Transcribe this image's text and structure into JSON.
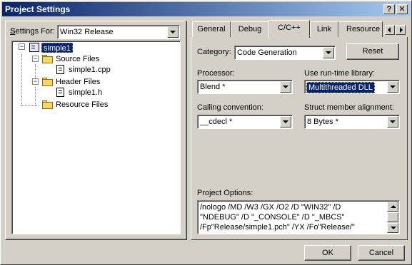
{
  "window": {
    "title": "Project Settings",
    "help_button": "?",
    "close_button": "✕"
  },
  "left_panel": {
    "settings_for_label": "Settings For:",
    "settings_for_value": "Win32 Release",
    "tree": {
      "root": "simple1",
      "source_files": "Source Files",
      "source_item": "simple1.cpp",
      "header_files": "Header Files",
      "header_item": "simple1.h",
      "resource_files": "Resource Files"
    }
  },
  "tabs": [
    "General",
    "Debug",
    "C/C++",
    "Link",
    "Resource"
  ],
  "active_tab": "C/C++",
  "cpp_page": {
    "category_label": "Category:",
    "category_value": "Code Generation",
    "reset_button": "Reset",
    "processor_label": "Processor:",
    "processor_value": "Blend *",
    "runtime_label": "Use run-time library:",
    "runtime_value": "Multithreaded DLL",
    "calling_label": "Calling convention:",
    "calling_value": "__cdecl *",
    "struct_label": "Struct member alignment:",
    "struct_value": "8 Bytes *",
    "project_options_label": "Project Options:",
    "project_options_lines": [
      "/nologo /MD /W3 /GX /O2 /D \"WIN32\" /D",
      "\"NDEBUG\" /D \"_CONSOLE\" /D \"_MBCS\"",
      "/Fp\"Release/simple1.pch\" /YX /Fo\"Release/\""
    ]
  },
  "footer": {
    "ok_button": "OK",
    "cancel_button": "Cancel"
  },
  "colors": {
    "title_bar_start": "#0a246a",
    "title_bar_end": "#a6caf0",
    "selection": "#0a246a",
    "dialog_face": "#d4d0c8"
  }
}
